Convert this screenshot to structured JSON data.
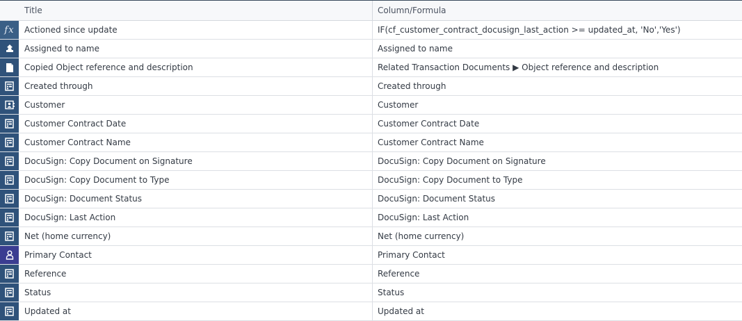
{
  "table": {
    "columns": {
      "title": "Title",
      "formula": "Column/Formula"
    },
    "rows": [
      {
        "icon": "formula-icon",
        "title": "Actioned since update",
        "formula": "IF(cf_customer_contract_docusign_last_action >= updated_at, 'No','Yes')"
      },
      {
        "icon": "assign-icon",
        "title": "Assigned to name",
        "formula": "Assigned to name"
      },
      {
        "icon": "document-icon",
        "title": "Copied Object reference and description",
        "formula": "Related Transaction Documents ▶ Object reference and description"
      },
      {
        "icon": "field-icon",
        "title": "Created through",
        "formula": "Created through"
      },
      {
        "icon": "contact-card-icon",
        "title": "Customer",
        "formula": "Customer"
      },
      {
        "icon": "field-icon",
        "title": "Customer Contract Date",
        "formula": "Customer Contract Date"
      },
      {
        "icon": "field-icon",
        "title": "Customer Contract Name",
        "formula": "Customer Contract Name"
      },
      {
        "icon": "field-icon",
        "title": "DocuSign: Copy Document on Signature",
        "formula": "DocuSign: Copy Document on Signature"
      },
      {
        "icon": "field-icon",
        "title": "DocuSign: Copy Document to Type",
        "formula": "DocuSign: Copy Document to Type"
      },
      {
        "icon": "field-icon",
        "title": "DocuSign: Document Status",
        "formula": "DocuSign: Document Status"
      },
      {
        "icon": "field-icon",
        "title": "DocuSign: Last Action",
        "formula": "DocuSign: Last Action"
      },
      {
        "icon": "field-icon",
        "title": "Net (home currency)",
        "formula": "Net (home currency)"
      },
      {
        "icon": "person-icon",
        "title": "Primary Contact",
        "formula": "Primary Contact"
      },
      {
        "icon": "field-icon",
        "title": "Reference",
        "formula": "Reference"
      },
      {
        "icon": "field-icon",
        "title": "Status",
        "formula": "Status"
      },
      {
        "icon": "field-icon",
        "title": "Updated at",
        "formula": "Updated at"
      }
    ]
  },
  "colors": {
    "icon_bg": "#2f527a",
    "person_icon_bg": "#3b3d91",
    "border": "#dcdfe4",
    "text": "#333a44"
  }
}
